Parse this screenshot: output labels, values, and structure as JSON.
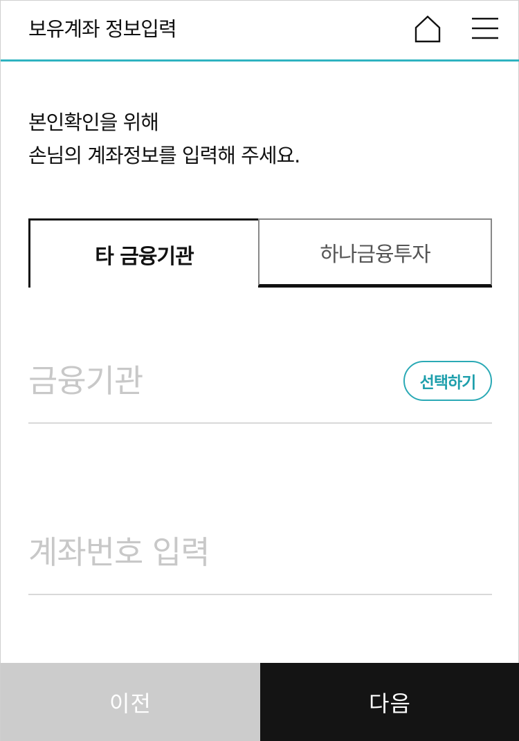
{
  "header": {
    "title": "보유계좌 정보입력",
    "home_icon": "home-icon",
    "menu_icon": "hamburger-menu-icon",
    "accent_color": "#2eb3c0"
  },
  "intro": {
    "line1": "본인확인을 위해",
    "line2": "손님의 계좌정보를 입력해 주세요."
  },
  "tabs": [
    {
      "label": "타 금융기관",
      "active": true
    },
    {
      "label": "하나금융투자",
      "active": false
    }
  ],
  "institution_field": {
    "placeholder": "금융기관",
    "select_label": "선택하기"
  },
  "account_field": {
    "placeholder": "계좌번호 입력",
    "value": ""
  },
  "footer": {
    "prev_label": "이전",
    "next_label": "다음"
  }
}
